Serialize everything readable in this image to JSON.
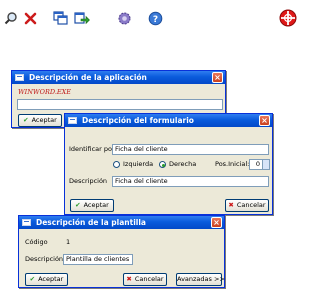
{
  "toolbar": {
    "icons": [
      "search-icon",
      "delete-icon",
      "copy-windows-icon",
      "export-arrow-icon",
      "settings-gear-icon",
      "help-icon",
      "target-icon"
    ]
  },
  "dialog_app": {
    "title": "Descripción de la aplicación",
    "value": "WINWORD.EXE",
    "accept_label": "Aceptar"
  },
  "dialog_form": {
    "title": "Descripción del formulario",
    "identify_label": "Identificar por",
    "identify_value": "Ficha del cliente",
    "radio_left_label": "Izquierda",
    "radio_right_label": "Derecha",
    "position_label": "Pos.Inicial:",
    "position_value": "0",
    "description_label": "Descripción",
    "description_value": "Ficha del cliente",
    "accept_label": "Aceptar",
    "cancel_label": "Cancelar"
  },
  "dialog_template": {
    "title": "Descripción de la plantilla",
    "code_label": "Código",
    "code_value": "1",
    "description_label": "Descripción",
    "description_value": "Plantilla de clientes",
    "accept_label": "Aceptar",
    "cancel_label": "Cancelar",
    "advanced_label": "Avanzadas >>"
  },
  "colors": {
    "title_bar": "#0a5bdc",
    "dialog_bg": "#ece9d8",
    "accent_red": "#cc1b1b",
    "accept_check": "#2a9a2a"
  }
}
